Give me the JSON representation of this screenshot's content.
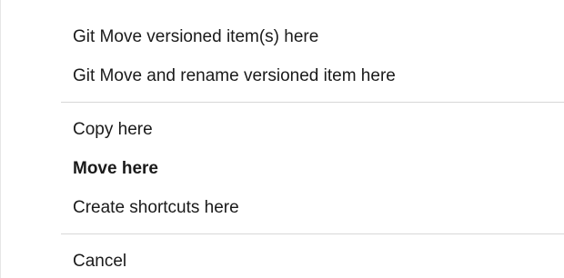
{
  "menu": {
    "items": [
      {
        "label": "Git Move versioned item(s) here"
      },
      {
        "label": "Git Move and rename versioned item here"
      },
      {
        "label": "Copy here"
      },
      {
        "label": "Move here",
        "is_default": true
      },
      {
        "label": "Create shortcuts here"
      },
      {
        "label": "Cancel"
      }
    ]
  }
}
